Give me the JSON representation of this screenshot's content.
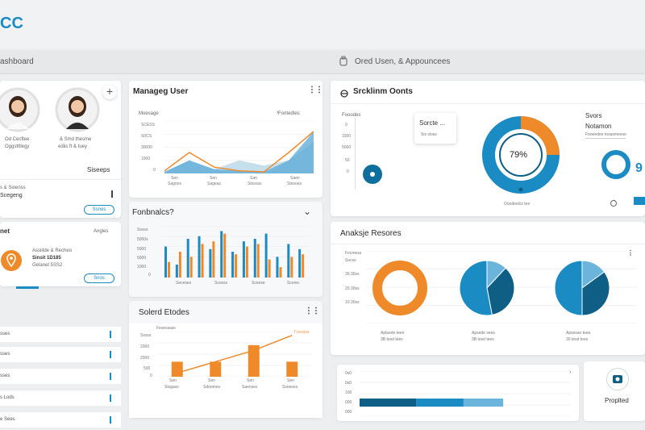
{
  "app": {
    "logo": "CC"
  },
  "nav": {
    "breadcrumb": "ashboard",
    "section": "Ored Usen, & Appouncees"
  },
  "colors": {
    "blue": "#1b8bc4",
    "lightblue": "#6bb5dc",
    "orange": "#ef8a2a",
    "navy": "#0e5e86"
  },
  "users_card": {
    "user1": "Od Cecftee",
    "user1_sub": "Oggstttlegy",
    "user2": "& Smd thesme",
    "user2_sub": "ediis ft & tuey",
    "section_label": "Siseeps",
    "item_label": "s & Sioenss",
    "item_title": "Scegeng",
    "button": "Ssnos"
  },
  "location_card": {
    "title": "net",
    "right_label": "Angles",
    "line1": "Assiitde & Recheo",
    "line2": "Sinsit 1D185",
    "line3": "Gelanet 5SS2",
    "button": "Snos"
  },
  "list_rows": [
    "sses",
    "sses",
    "sses",
    "s Lods",
    "e Sees"
  ],
  "manage_card": {
    "title": "Manageg User",
    "legend_left": "Moesage",
    "legend_right": "Fontedtes",
    "y_ticks": [
      "SCESS",
      "S0CS",
      "30000",
      "1000",
      "0"
    ],
    "x_labels": [
      "Sen",
      "Sen",
      "San",
      "Saen"
    ],
    "x_sub": [
      "Sagoos",
      "Sageas",
      "Stssoss",
      "Stesoes"
    ],
    "chart_data": {
      "type": "area",
      "x": [
        "Sen",
        "",
        "Sen",
        "",
        "San",
        "",
        "Saen"
      ],
      "series": [
        {
          "values": [
            5,
            40,
            12,
            5,
            3,
            40,
            80
          ]
        },
        {
          "values": [
            3,
            25,
            8,
            25,
            15,
            25,
            60
          ]
        }
      ]
    }
  },
  "features_card": {
    "title": "Fonbnalcs?",
    "y_ticks": [
      "Sssss",
      "5000s",
      "5000",
      "5000",
      "1000",
      "0"
    ],
    "x_labels": [
      "Seceses",
      "Scesss",
      "Sceese",
      "Scerec"
    ],
    "chart_data": {
      "type": "bar",
      "series": [
        {
          "values": [
            60,
            25,
            75,
            80,
            55,
            90,
            50,
            70,
            75,
            85,
            40,
            65,
            55
          ]
        },
        {
          "values": [
            30,
            50,
            40,
            65,
            70,
            85,
            45,
            60,
            65,
            35,
            20,
            40,
            45
          ]
        }
      ]
    }
  },
  "sales_card": {
    "title": "Solerd Etodes",
    "legend": "Fesessass",
    "legend2": "Focssss",
    "y_ticks": [
      "Sssss",
      "2000",
      "2000",
      "500",
      "0"
    ],
    "x_labels": [
      "Sen",
      "Sen",
      "Sen",
      "Sen"
    ],
    "x_sub": [
      "Stsgass",
      "Sdoomes",
      "Saenses",
      "Ssoeses"
    ],
    "chart_data": {
      "type": "bar",
      "categories": [
        "Sen",
        "Sen",
        "Sen",
        "Sen"
      ],
      "values": [
        20,
        20,
        42,
        20
      ],
      "line": [
        5,
        20,
        35,
        55
      ]
    }
  },
  "stats_card": {
    "title": "Srcklinm Oonts",
    "left_legend": "Fooodes",
    "y_ticks": [
      "0",
      "1000",
      "5000",
      "50",
      "0"
    ],
    "tooltip_title": "Sorcte ...",
    "tooltip_body": "Sis sloss",
    "donut_value": "79%",
    "donut_label": "Ooodeelcs tee",
    "right_title": "Svors",
    "right_subtitle": "Notamon",
    "right_sub2": "Fooeedee tosasmeese",
    "right_value": "9"
  },
  "analysis_card": {
    "title": "Anaksje Resores",
    "y_ticks": [
      "Focmess",
      "Socss",
      "30.30ss",
      "20.30ss",
      "10.30ss"
    ],
    "pie_labels": [
      "Aptsede teen",
      "Apsede sees",
      "Apsesse teea"
    ],
    "pie_subs": [
      "3B tesd tees",
      "3B tesd tees",
      "30 tesd tees"
    ],
    "chart_data": {
      "type": "pie",
      "charts": [
        {
          "values": [
            100
          ]
        },
        {
          "values": [
            12,
            35,
            53
          ]
        },
        {
          "values": [
            15,
            35,
            50
          ]
        }
      ]
    }
  },
  "bottom_card": {
    "y_ticks": [
      "0s0",
      "0s0",
      "100",
      "000",
      "000"
    ],
    "chart_data": {
      "type": "bar",
      "values": [
        30,
        25,
        21
      ]
    }
  },
  "profile_card": {
    "label": "Proplted"
  }
}
